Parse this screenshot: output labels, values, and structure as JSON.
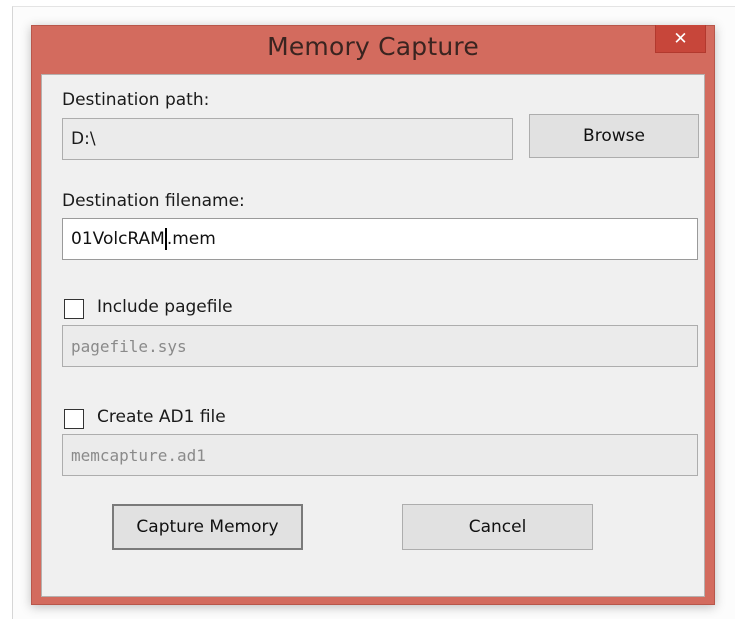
{
  "window": {
    "title": "Memory Capture",
    "close_glyph": "✕"
  },
  "destination_path": {
    "label": "Destination path:",
    "value": "D:\\",
    "browse_label": "Browse"
  },
  "destination_filename": {
    "label": "Destination filename:",
    "value_before_caret": "01VolcRAM",
    "value_after_caret": ".mem"
  },
  "pagefile": {
    "checkbox_label": "Include pagefile",
    "checked": false,
    "value": "pagefile.sys"
  },
  "ad1": {
    "checkbox_label": "Create AD1 file",
    "checked": false,
    "value": "memcapture.ad1"
  },
  "buttons": {
    "capture_label": "Capture Memory",
    "cancel_label": "Cancel"
  },
  "colors": {
    "titlebar": "#d36b5e",
    "close_button": "#c7463a",
    "client_background": "#f0f0f0"
  }
}
